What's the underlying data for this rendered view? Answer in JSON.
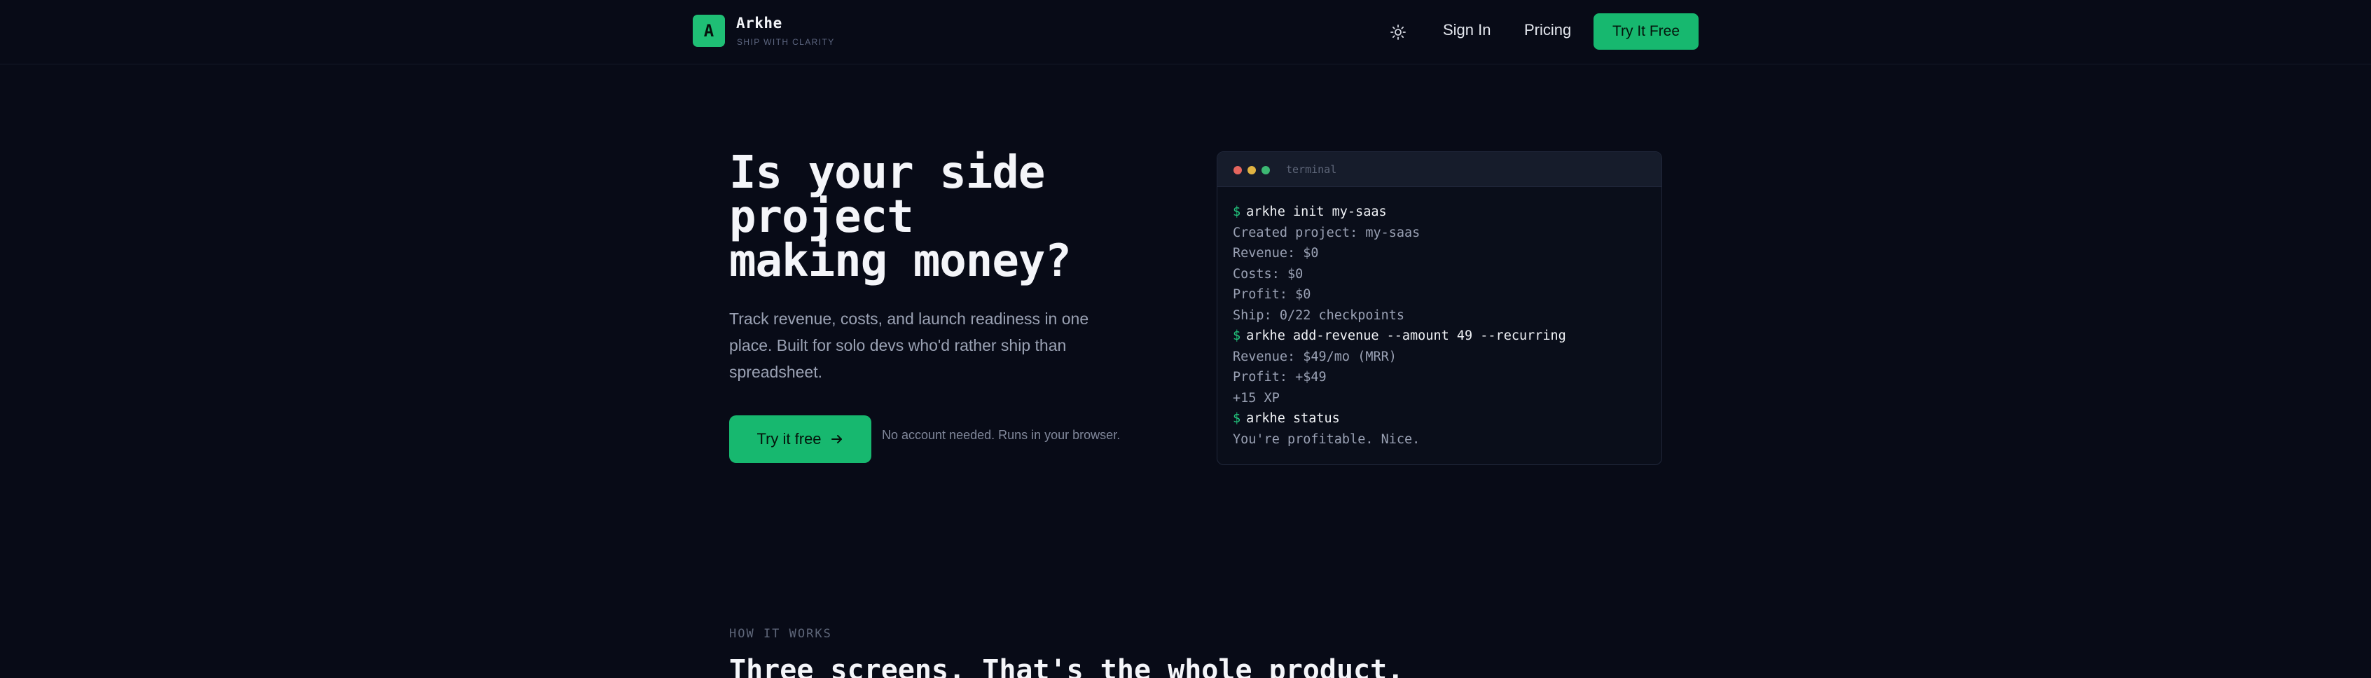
{
  "header": {
    "logo_letter": "A",
    "brand_name": "Arkhe",
    "brand_tagline": "SHIP WITH CLARITY",
    "theme_icon": "sun-icon",
    "nav": {
      "sign_in": "Sign In",
      "pricing": "Pricing",
      "cta": "Try It Free"
    }
  },
  "hero": {
    "title_lines": [
      "Is your side",
      "project",
      "making money?"
    ],
    "subtitle": "Track revenue, costs, and launch readiness in one place. Built for solo devs who'd rather ship than spreadsheet.",
    "cta_label": "Try it free",
    "cta_icon": "arrow-right-icon",
    "note": "No account needed. Runs in your browser."
  },
  "terminal": {
    "title": "terminal",
    "prompt_symbol": "$",
    "lines": [
      {
        "kind": "cmd",
        "text": "arkhe init my-saas"
      },
      {
        "kind": "out",
        "text": "Created project: my-saas"
      },
      {
        "kind": "out",
        "text": "Revenue: $0"
      },
      {
        "kind": "out",
        "text": "Costs: $0"
      },
      {
        "kind": "out",
        "text": "Profit: $0"
      },
      {
        "kind": "out",
        "text": "Ship: 0/22 checkpoints"
      },
      {
        "kind": "cmd",
        "text": "arkhe add-revenue --amount 49 --recurring"
      },
      {
        "kind": "out",
        "text": "Revenue: $49/mo (MRR)"
      },
      {
        "kind": "out",
        "text": "Profit: +$49"
      },
      {
        "kind": "out",
        "text": "+15 XP"
      },
      {
        "kind": "cmd",
        "text": "arkhe status"
      },
      {
        "kind": "out",
        "text": "You're profitable. Nice."
      }
    ],
    "colors": {
      "red": "#e5655e",
      "yellow": "#e0b342",
      "green": "#3cb873"
    }
  },
  "how_it_works": {
    "label": "HOW IT WORKS",
    "title": "Three screens. That's the whole product."
  },
  "colors": {
    "accent": "#17b86f",
    "background": "#080b17"
  }
}
